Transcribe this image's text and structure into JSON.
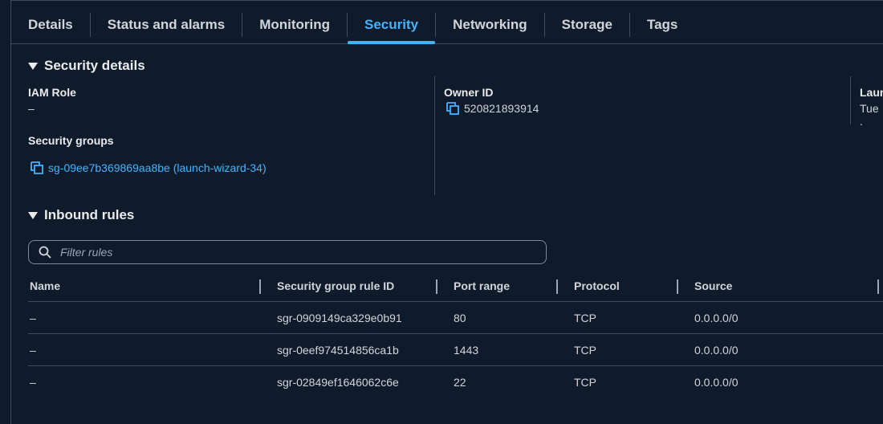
{
  "tabs": [
    {
      "label": "Details"
    },
    {
      "label": "Status and alarms"
    },
    {
      "label": "Monitoring"
    },
    {
      "label": "Security",
      "active": true
    },
    {
      "label": "Networking"
    },
    {
      "label": "Storage"
    },
    {
      "label": "Tags"
    }
  ],
  "security_details": {
    "title": "Security details",
    "iam_role_label": "IAM Role",
    "iam_role_value": "–",
    "owner_id_label": "Owner ID",
    "owner_id_value": "520821893914",
    "launch_label": "Laun",
    "launch_value": "Tue .",
    "security_groups_label": "Security groups",
    "security_group_link": "sg-09ee7b369869aa8be (launch-wizard-34)"
  },
  "inbound_rules": {
    "title": "Inbound rules",
    "filter_placeholder": "Filter rules",
    "columns": [
      "Name",
      "Security group rule ID",
      "Port range",
      "Protocol",
      "Source"
    ],
    "rows": [
      {
        "name": "–",
        "rule_id": "sgr-0909149ca329e0b91",
        "port": "80",
        "protocol": "TCP",
        "source": "0.0.0.0/0"
      },
      {
        "name": "–",
        "rule_id": "sgr-0eef974514856ca1b",
        "port": "1443",
        "protocol": "TCP",
        "source": "0.0.0.0/0"
      },
      {
        "name": "–",
        "rule_id": "sgr-02849ef1646062c6e",
        "port": "22",
        "protocol": "TCP",
        "source": "0.0.0.0/0"
      }
    ]
  },
  "colors": {
    "background": "#0f1b2a",
    "accent": "#42b4ff",
    "divider": "#414d5c",
    "text": "#d1d5db"
  }
}
